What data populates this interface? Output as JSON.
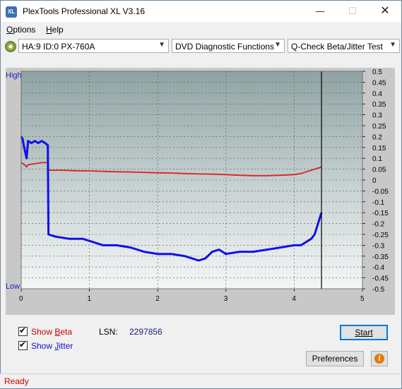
{
  "window": {
    "title": "PlexTools Professional XL V3.16",
    "icon_label": "XL",
    "controls": {
      "minimize": "—",
      "maximize": "☐",
      "close": "✕"
    }
  },
  "menu": {
    "options": {
      "underline": "O",
      "rest": "ptions"
    },
    "help": {
      "underline": "H",
      "rest": "elp"
    }
  },
  "toolbar": {
    "drive": "HA:9 ID:0  PX-760A",
    "function": "DVD Diagnostic Functions",
    "test": "Q-Check Beta/Jitter Test",
    "arrow": "▼"
  },
  "chart_labels": {
    "high": "High",
    "low": "Low"
  },
  "chart_data": {
    "type": "line",
    "title": "",
    "xlabel": "",
    "ylabel": "",
    "xlim": [
      0,
      5
    ],
    "ylim": [
      -0.5,
      0.5
    ],
    "x_ticks": [
      "0",
      "1",
      "2",
      "3",
      "4",
      "5"
    ],
    "y_ticks": [
      "0.5",
      "0.45",
      "0.4",
      "0.35",
      "0.3",
      "0.25",
      "0.2",
      "0.15",
      "0.1",
      "0.05",
      "0",
      "-0.05",
      "-0.1",
      "-0.15",
      "-0.2",
      "-0.25",
      "-0.3",
      "-0.35",
      "-0.4",
      "-0.45",
      "-0.5"
    ],
    "end_marker_x": 4.4,
    "grid": true,
    "series": [
      {
        "name": "Beta",
        "color": "#dd2020",
        "x": [
          0.0,
          0.05,
          0.08,
          0.1,
          0.2,
          0.3,
          0.39,
          0.4,
          0.6,
          0.8,
          1.0,
          1.2,
          1.4,
          1.6,
          1.8,
          2.0,
          2.2,
          2.4,
          2.6,
          2.8,
          3.0,
          3.2,
          3.4,
          3.6,
          3.8,
          4.0,
          4.1,
          4.2,
          4.3,
          4.4
        ],
        "y": [
          0.08,
          0.07,
          0.06,
          0.07,
          0.075,
          0.08,
          0.08,
          0.045,
          0.045,
          0.043,
          0.042,
          0.04,
          0.038,
          0.037,
          0.035,
          0.033,
          0.032,
          0.03,
          0.028,
          0.027,
          0.025,
          0.022,
          0.02,
          0.02,
          0.022,
          0.025,
          0.03,
          0.04,
          0.05,
          0.06
        ]
      },
      {
        "name": "Jitter",
        "color": "#1010ee",
        "x": [
          0.0,
          0.02,
          0.05,
          0.08,
          0.1,
          0.15,
          0.2,
          0.25,
          0.3,
          0.35,
          0.39,
          0.4,
          0.5,
          0.7,
          0.9,
          1.0,
          1.2,
          1.4,
          1.6,
          1.8,
          2.0,
          2.2,
          2.4,
          2.6,
          2.7,
          2.8,
          2.9,
          3.0,
          3.2,
          3.4,
          3.6,
          3.8,
          4.0,
          4.1,
          4.2,
          4.25,
          4.3,
          4.35,
          4.4
        ],
        "y": [
          0.2,
          0.19,
          0.14,
          0.1,
          0.18,
          0.17,
          0.18,
          0.17,
          0.18,
          0.17,
          0.16,
          -0.25,
          -0.26,
          -0.27,
          -0.27,
          -0.28,
          -0.3,
          -0.3,
          -0.31,
          -0.33,
          -0.34,
          -0.34,
          -0.35,
          -0.37,
          -0.36,
          -0.33,
          -0.32,
          -0.34,
          -0.33,
          -0.33,
          -0.32,
          -0.31,
          -0.3,
          -0.3,
          -0.28,
          -0.27,
          -0.25,
          -0.2,
          -0.15
        ]
      }
    ]
  },
  "panel": {
    "show_beta": {
      "prefix": "Show ",
      "underline": "B",
      "rest": "eta",
      "color": "#cc0000"
    },
    "show_jitter": {
      "prefix": "Show ",
      "underline": "J",
      "rest": "itter",
      "color": "#1010cc"
    },
    "lsn_label": "LSN:",
    "lsn_value": "2297856",
    "start_button": "Start",
    "preferences_button": "Preferences",
    "info_icon": "i"
  },
  "status": {
    "text": "Ready"
  }
}
